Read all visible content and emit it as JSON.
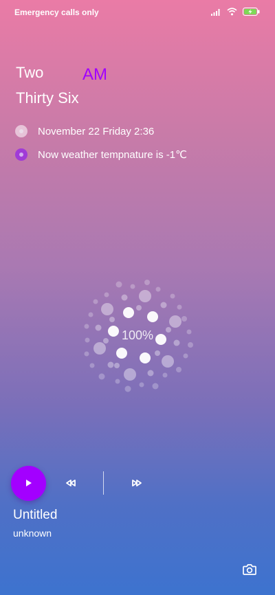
{
  "status_bar": {
    "carrier_text": "Emergency calls only",
    "icons": [
      "signal-icon",
      "wifi-icon",
      "battery-charging-icon"
    ],
    "battery_color": "#7ed957"
  },
  "clock": {
    "hour_words": "Two",
    "minute_words": "Thirty  Six",
    "ampm": "AM",
    "ampm_color": "#a100ff"
  },
  "info": {
    "date_text": "November  22  Friday  2:36",
    "weather_text": "Now weather tempnature is -1℃"
  },
  "loader": {
    "percent_text": "100%",
    "progress": 1.0
  },
  "player": {
    "accent_color": "#a300ff",
    "title": "Untitled",
    "artist": "unknown",
    "controls": [
      "play-icon",
      "rewind-icon",
      "fast-forward-icon"
    ]
  },
  "shortcut": {
    "icon": "camera-icon"
  }
}
